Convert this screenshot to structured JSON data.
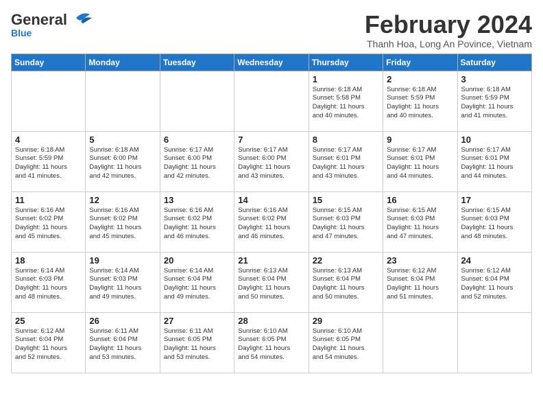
{
  "header": {
    "logo_general": "General",
    "logo_blue": "Blue",
    "month_title": "February 2024",
    "subtitle": "Thanh Hoa, Long An Povince, Vietnam"
  },
  "columns": [
    "Sunday",
    "Monday",
    "Tuesday",
    "Wednesday",
    "Thursday",
    "Friday",
    "Saturday"
  ],
  "weeks": [
    [
      {
        "day": "",
        "info": ""
      },
      {
        "day": "",
        "info": ""
      },
      {
        "day": "",
        "info": ""
      },
      {
        "day": "",
        "info": ""
      },
      {
        "day": "1",
        "info": "Sunrise: 6:18 AM\nSunset: 5:58 PM\nDaylight: 11 hours\nand 40 minutes."
      },
      {
        "day": "2",
        "info": "Sunrise: 6:18 AM\nSunset: 5:59 PM\nDaylight: 11 hours\nand 40 minutes."
      },
      {
        "day": "3",
        "info": "Sunrise: 6:18 AM\nSunset: 5:59 PM\nDaylight: 11 hours\nand 41 minutes."
      }
    ],
    [
      {
        "day": "4",
        "info": "Sunrise: 6:18 AM\nSunset: 5:59 PM\nDaylight: 11 hours\nand 41 minutes."
      },
      {
        "day": "5",
        "info": "Sunrise: 6:18 AM\nSunset: 6:00 PM\nDaylight: 11 hours\nand 42 minutes."
      },
      {
        "day": "6",
        "info": "Sunrise: 6:17 AM\nSunset: 6:00 PM\nDaylight: 11 hours\nand 42 minutes."
      },
      {
        "day": "7",
        "info": "Sunrise: 6:17 AM\nSunset: 6:00 PM\nDaylight: 11 hours\nand 43 minutes."
      },
      {
        "day": "8",
        "info": "Sunrise: 6:17 AM\nSunset: 6:01 PM\nDaylight: 11 hours\nand 43 minutes."
      },
      {
        "day": "9",
        "info": "Sunrise: 6:17 AM\nSunset: 6:01 PM\nDaylight: 11 hours\nand 44 minutes."
      },
      {
        "day": "10",
        "info": "Sunrise: 6:17 AM\nSunset: 6:01 PM\nDaylight: 11 hours\nand 44 minutes."
      }
    ],
    [
      {
        "day": "11",
        "info": "Sunrise: 6:16 AM\nSunset: 6:02 PM\nDaylight: 11 hours\nand 45 minutes."
      },
      {
        "day": "12",
        "info": "Sunrise: 6:16 AM\nSunset: 6:02 PM\nDaylight: 11 hours\nand 45 minutes."
      },
      {
        "day": "13",
        "info": "Sunrise: 6:16 AM\nSunset: 6:02 PM\nDaylight: 11 hours\nand 46 minutes."
      },
      {
        "day": "14",
        "info": "Sunrise: 6:16 AM\nSunset: 6:02 PM\nDaylight: 11 hours\nand 46 minutes."
      },
      {
        "day": "15",
        "info": "Sunrise: 6:15 AM\nSunset: 6:03 PM\nDaylight: 11 hours\nand 47 minutes."
      },
      {
        "day": "16",
        "info": "Sunrise: 6:15 AM\nSunset: 6:03 PM\nDaylight: 11 hours\nand 47 minutes."
      },
      {
        "day": "17",
        "info": "Sunrise: 6:15 AM\nSunset: 6:03 PM\nDaylight: 11 hours\nand 48 minutes."
      }
    ],
    [
      {
        "day": "18",
        "info": "Sunrise: 6:14 AM\nSunset: 6:03 PM\nDaylight: 11 hours\nand 48 minutes."
      },
      {
        "day": "19",
        "info": "Sunrise: 6:14 AM\nSunset: 6:03 PM\nDaylight: 11 hours\nand 49 minutes."
      },
      {
        "day": "20",
        "info": "Sunrise: 6:14 AM\nSunset: 6:04 PM\nDaylight: 11 hours\nand 49 minutes."
      },
      {
        "day": "21",
        "info": "Sunrise: 6:13 AM\nSunset: 6:04 PM\nDaylight: 11 hours\nand 50 minutes."
      },
      {
        "day": "22",
        "info": "Sunrise: 6:13 AM\nSunset: 6:04 PM\nDaylight: 11 hours\nand 50 minutes."
      },
      {
        "day": "23",
        "info": "Sunrise: 6:12 AM\nSunset: 6:04 PM\nDaylight: 11 hours\nand 51 minutes."
      },
      {
        "day": "24",
        "info": "Sunrise: 6:12 AM\nSunset: 6:04 PM\nDaylight: 11 hours\nand 52 minutes."
      }
    ],
    [
      {
        "day": "25",
        "info": "Sunrise: 6:12 AM\nSunset: 6:04 PM\nDaylight: 11 hours\nand 52 minutes."
      },
      {
        "day": "26",
        "info": "Sunrise: 6:11 AM\nSunset: 6:04 PM\nDaylight: 11 hours\nand 53 minutes."
      },
      {
        "day": "27",
        "info": "Sunrise: 6:11 AM\nSunset: 6:05 PM\nDaylight: 11 hours\nand 53 minutes."
      },
      {
        "day": "28",
        "info": "Sunrise: 6:10 AM\nSunset: 6:05 PM\nDaylight: 11 hours\nand 54 minutes."
      },
      {
        "day": "29",
        "info": "Sunrise: 6:10 AM\nSunset: 6:05 PM\nDaylight: 11 hours\nand 54 minutes."
      },
      {
        "day": "",
        "info": ""
      },
      {
        "day": "",
        "info": ""
      }
    ]
  ]
}
